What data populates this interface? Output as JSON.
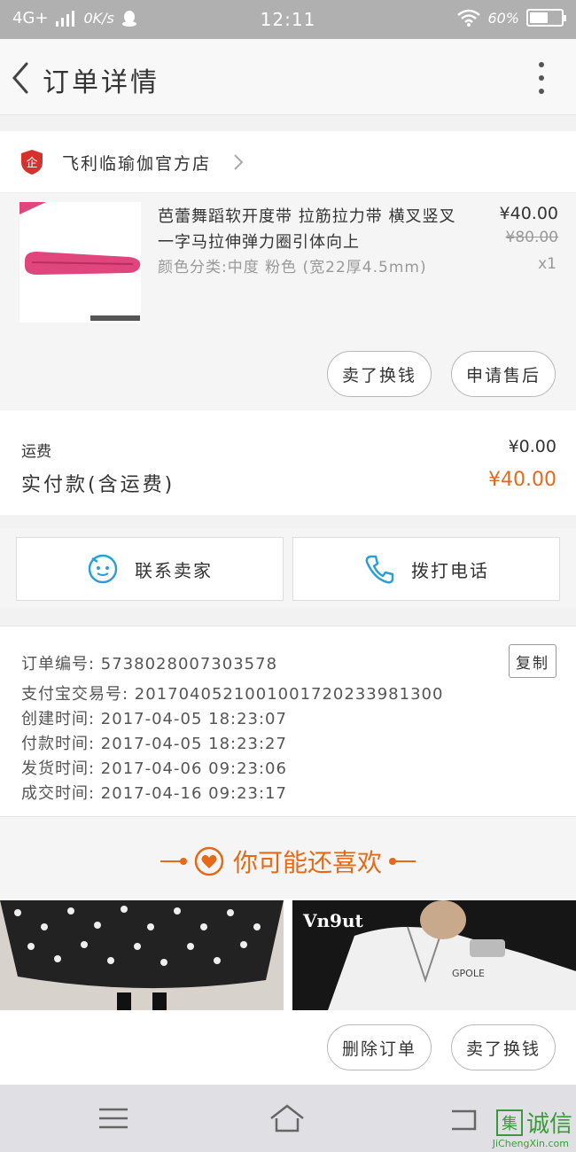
{
  "status_bar": {
    "network": "4G+",
    "speed": "0K/s",
    "time": "12:11",
    "battery": "60%",
    "battery_level": 0.6
  },
  "header": {
    "title": "订单详情"
  },
  "store": {
    "name": "飞利临瑜伽官方店",
    "badge": "企"
  },
  "product": {
    "title": "芭蕾舞蹈软开度带 拉筋拉力带 横叉竖叉一字马拉伸弹力圈引体向上",
    "spec": "颜色分类:中度 粉色 (宽22厚4.5mm)",
    "price": "¥40.00",
    "original_price": "¥80.00",
    "quantity": "x1"
  },
  "actions": {
    "exchange": "卖了换钱",
    "after_sale": "申请售后",
    "delete_order": "删除订单",
    "exchange_bottom": "卖了换钱"
  },
  "fees": {
    "shipping_label": "运费",
    "shipping_value": "¥0.00",
    "paid_label": "实付款(含运费)",
    "paid_value": "¥40.00"
  },
  "contact": {
    "seller": "联系卖家",
    "call": "拨打电话"
  },
  "order_info": {
    "copy": "复制",
    "rows": [
      "订单编号: 5738028007303578",
      "支付宝交易号: 2017040521001001720233981300",
      "创建时间: 2017-04-05 18:23:07",
      "付款时间: 2017-04-05 18:23:27",
      "发货时间: 2017-04-06 09:23:06",
      "成交时间: 2017-04-16 09:23:17"
    ]
  },
  "recommend": {
    "title": "你可能还喜欢",
    "right_image_text": "Vn9ut",
    "shirt_text": "GPOLE"
  },
  "watermark": {
    "box": "集",
    "text": "诚信",
    "sub": "JiChengXin.com"
  },
  "colors": {
    "accent": "#e46a1a",
    "contact_icon": "#2a9fd6",
    "store_badge": "#d6322c"
  }
}
